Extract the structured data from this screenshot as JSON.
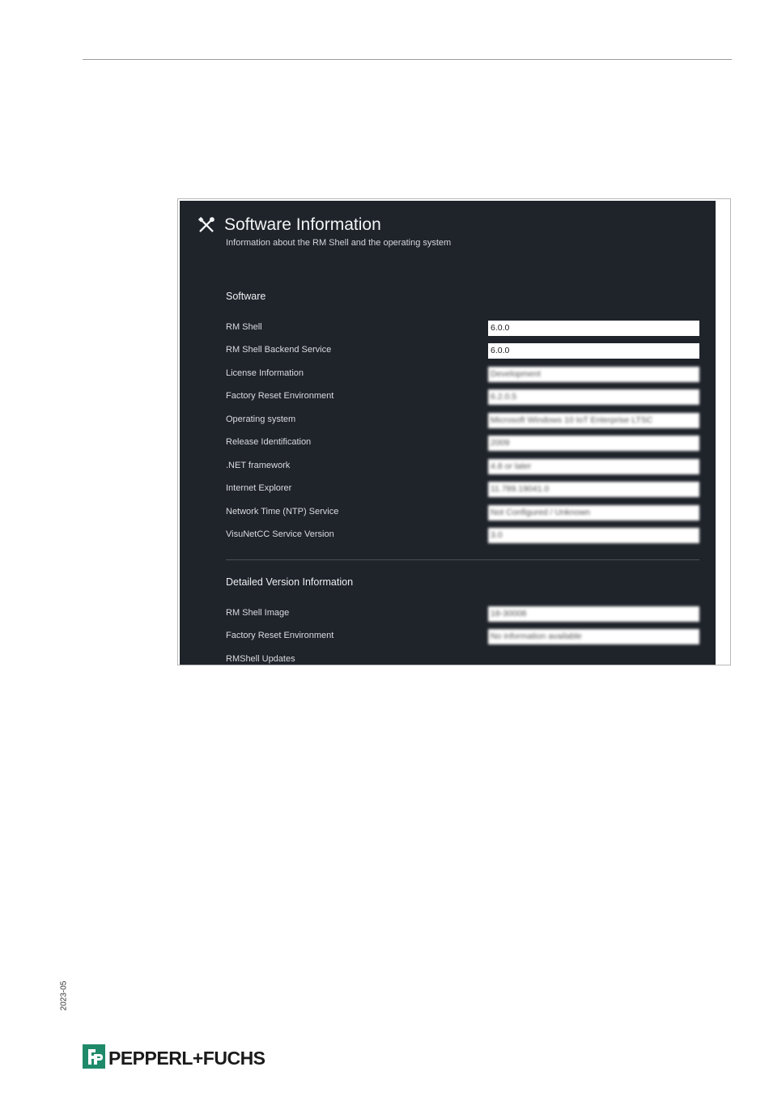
{
  "document": {
    "date_code": "2023-05",
    "brand": "PEPPERL+FUCHS"
  },
  "screenshot": {
    "title": "Software Information",
    "subtitle": "Information about the RM Shell and the operating system",
    "icon": "tools-icon",
    "sections": [
      {
        "heading": "Software",
        "rows": [
          {
            "label": "RM Shell",
            "value": "6.0.0"
          },
          {
            "label": "RM Shell Backend Service",
            "value": "6.0.0"
          },
          {
            "label": "License Information",
            "value": "Development"
          },
          {
            "label": "Factory Reset Environment",
            "value": "6.2.0.5"
          },
          {
            "label": "Operating system",
            "value": "Microsoft Windows 10 IoT Enterprise LTSC"
          },
          {
            "label": "Release Identification",
            "value": "2009"
          },
          {
            "label": ".NET framework",
            "value": "4.8 or later"
          },
          {
            "label": "Internet Explorer",
            "value": "11.789.19041.0"
          },
          {
            "label": "Network Time (NTP) Service",
            "value": "Not Configured / Unknown"
          },
          {
            "label": "VisuNetCC Service Version",
            "value": "3.0"
          }
        ]
      },
      {
        "heading": "Detailed Version Information",
        "rows": [
          {
            "label": "RM Shell Image",
            "value": "18-30008"
          },
          {
            "label": "Factory Reset Environment",
            "value": "No information available"
          },
          {
            "label": "RMShell Updates",
            "value": ""
          }
        ]
      }
    ]
  }
}
